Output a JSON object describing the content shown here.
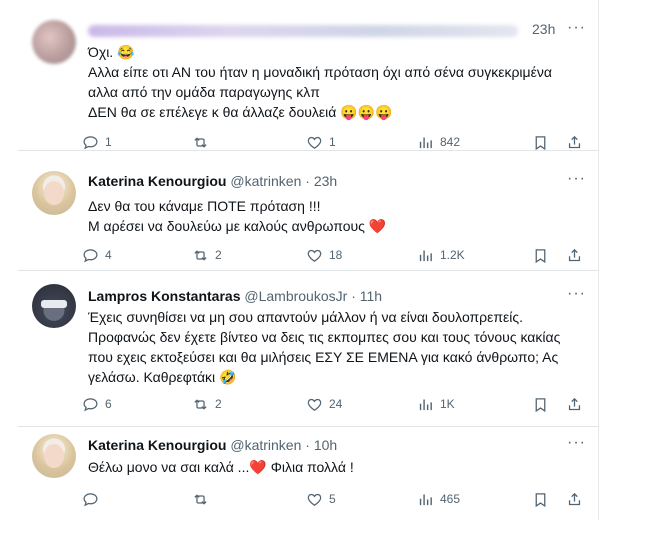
{
  "tweets": [
    {
      "time": "23h",
      "lines": [
        "Όχι. 😂",
        "Αλλα είπε οτι ΑΝ του ήταν η μοναδική πρόταση όχι από σένα συγκεκριμένα",
        "αλλα από την ομάδα παραγωγης κλπ",
        "ΔΕΝ θα σε επέλεγε κ θα άλλαζε δουλειά 😛😛😛"
      ],
      "replies": "1",
      "retweets": "",
      "likes": "1",
      "views": "842"
    },
    {
      "name": "Katerina Kenourgiou",
      "handle": "@katrinken",
      "time": "23h",
      "lines": [
        "Δεν θα του κάναμε ΠΟΤΕ πρόταση !!!",
        "Μ αρέσει να δουλεύω με καλούς ανθρωπους"
      ],
      "heart_emoji": "❤️",
      "replies": "4",
      "retweets": "2",
      "likes": "18",
      "views": "1.2K"
    },
    {
      "name": "Lampros Konstantaras",
      "handle": "@LambroukosJr",
      "time": "11h",
      "lines": [
        "Έχεις συνηθίσει να μη σου απαντούν μάλλον ή να είναι δουλοπρεπείς.",
        "Προφανώς δεν έχετε βίντεο να δεις τις εκπομπες σου και τους τόνους κακίας",
        "που εχεις εκτοξεύσει και θα μιλήσεις ΕΣΥ ΣΕ ΕΜΕΝΑ για κακό άνθρωπο; Ας",
        "γελάσω. Καθρεφτάκι 🤣"
      ],
      "replies": "6",
      "retweets": "2",
      "likes": "24",
      "views": "1K"
    },
    {
      "name": "Katerina Kenourgiou",
      "handle": "@katrinken",
      "time": "10h",
      "line_a": "Θέλω μονο να σαι καλά ...",
      "heart_emoji": "❤️",
      "line_b": "Φιλια πολλά !",
      "replies": "",
      "retweets": "",
      "likes": "5",
      "views": "465"
    }
  ],
  "icons": [
    "reply-icon",
    "retweet-icon",
    "like-icon",
    "views-icon",
    "bookmark-icon",
    "share-icon",
    "more-icon"
  ],
  "colors": {
    "text": "#0f1419",
    "muted": "#536471",
    "heart": "#e0245e",
    "border": "#e1e5e8"
  }
}
